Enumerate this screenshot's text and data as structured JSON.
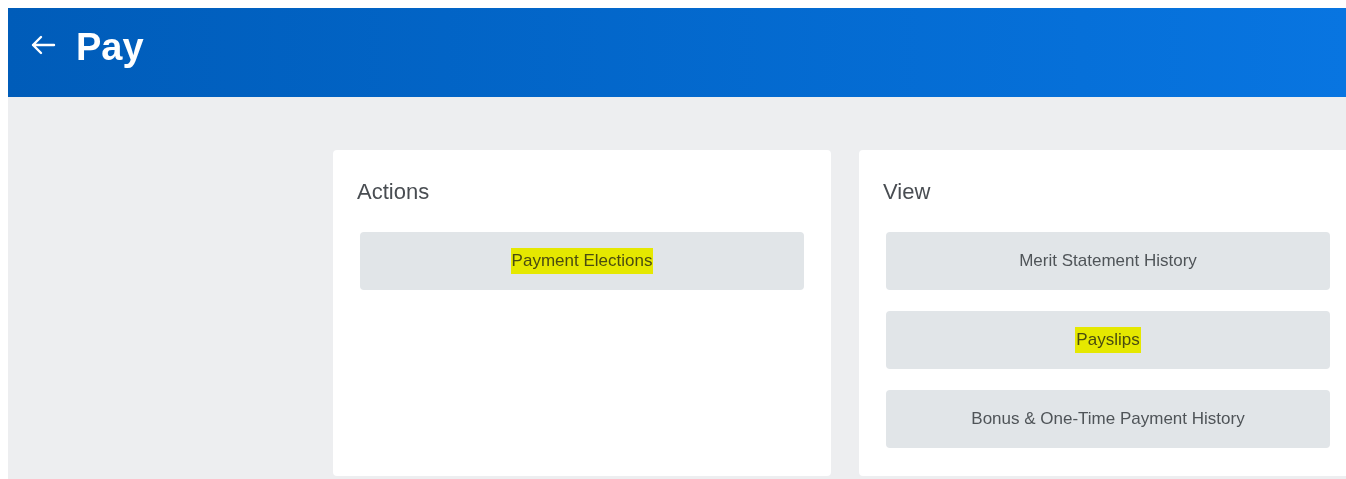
{
  "header": {
    "title": "Pay"
  },
  "cards": [
    {
      "title": "Actions",
      "buttons": [
        {
          "label": "Payment Elections",
          "highlighted": true
        }
      ]
    },
    {
      "title": "View",
      "buttons": [
        {
          "label": "Merit Statement History",
          "highlighted": false
        },
        {
          "label": "Payslips",
          "highlighted": true
        },
        {
          "label": "Bonus & One-Time Payment History",
          "highlighted": false
        }
      ]
    }
  ]
}
